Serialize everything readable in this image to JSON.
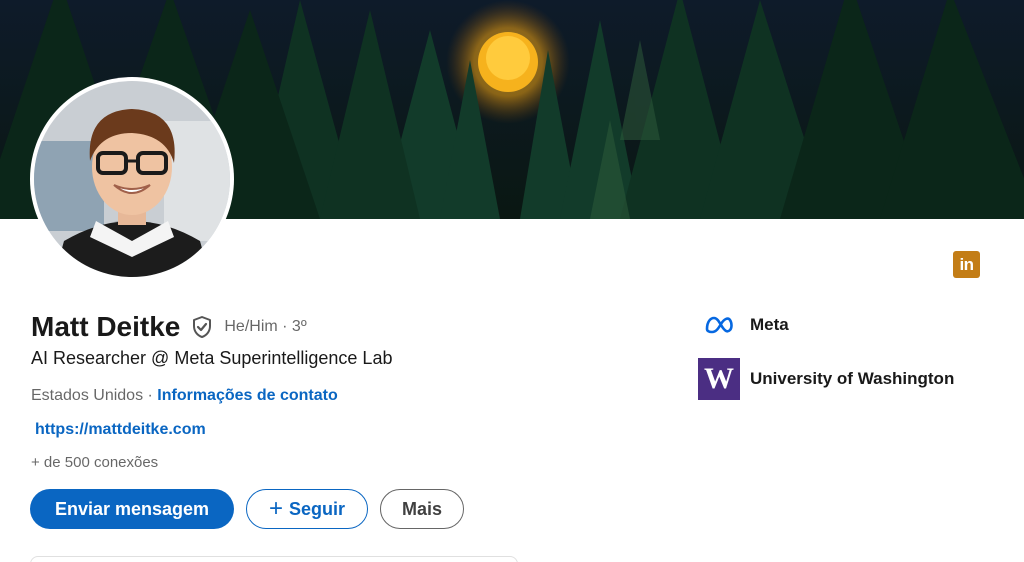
{
  "profile": {
    "name": "Matt Deitke",
    "pronouns": "He/Him · 3º",
    "headline": "AI Researcher @ Meta Superintelligence Lab",
    "location": "Estados Unidos",
    "location_separator": " · ",
    "contact_link": "Informações de contato",
    "website": "https://mattdeitke.com",
    "connections": "+ de 500 conexões"
  },
  "actions": {
    "message_label": "Enviar mensagem",
    "follow_icon": "+",
    "follow_label": "Seguir",
    "more_label": "Mais"
  },
  "organizations": [
    {
      "name": "Meta",
      "icon": "meta-logo"
    },
    {
      "name": "University of Washington",
      "icon": "uw-logo",
      "logo_text": "W"
    }
  ],
  "badge": {
    "text": "in",
    "icon": "linkedin-icon"
  },
  "icons": {
    "verified": "verified-shield-icon"
  },
  "colors": {
    "primary": "#0a66c2",
    "linkedin_badge": "#c37d16",
    "uw_purple": "#4b2e83",
    "meta_blue": "#0668e1"
  }
}
